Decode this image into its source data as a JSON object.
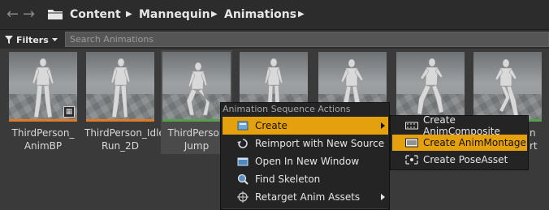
{
  "breadcrumb": {
    "items": [
      "Content",
      "Mannequin",
      "Animations"
    ]
  },
  "filter": {
    "label": "Filters",
    "search_placeholder": "Search Animations"
  },
  "assets": [
    {
      "label": "ThirdPerson_\nAnimBP",
      "stripe_color": "#e07b25",
      "badge": "blueprint-badge"
    },
    {
      "label": "ThirdPerson_Idle\nRun_2D",
      "stripe_color": "#e07b25"
    },
    {
      "label": "ThirdPerson\nJump",
      "stripe_color": "#55a04a"
    },
    {
      "label": "",
      "stripe_color": "#55a04a"
    },
    {
      "label": "",
      "stripe_color": "#55a04a"
    },
    {
      "label": "",
      "stripe_color": "#55a04a"
    },
    {
      "label": "",
      "stripe_color": "#55a04a"
    }
  ],
  "partial_labels": {
    "asset7_line1": "n",
    "asset7_line2": "rt"
  },
  "context_menu": {
    "header": "Animation Sequence Actions",
    "items": [
      {
        "label": "Create",
        "icon": "create-icon",
        "has_submenu": true
      },
      {
        "label": "Reimport with New Source",
        "icon": "reimport-icon"
      },
      {
        "label": "Open In New Window",
        "icon": "open-window-icon"
      },
      {
        "label": "Find Skeleton",
        "icon": "find-icon"
      },
      {
        "label": "Retarget Anim Assets",
        "icon": "retarget-icon",
        "has_submenu": true
      }
    ]
  },
  "submenu": {
    "items": [
      {
        "label": "Create AnimComposite",
        "icon": "anim-composite-icon"
      },
      {
        "label": "Create AnimMontage",
        "icon": "anim-montage-icon"
      },
      {
        "label": "Create PoseAsset",
        "icon": "pose-asset-icon"
      }
    ]
  },
  "colors": {
    "highlight": "#e5a00d",
    "background": "#3a3a3a",
    "bar": "#2c2c2c"
  }
}
